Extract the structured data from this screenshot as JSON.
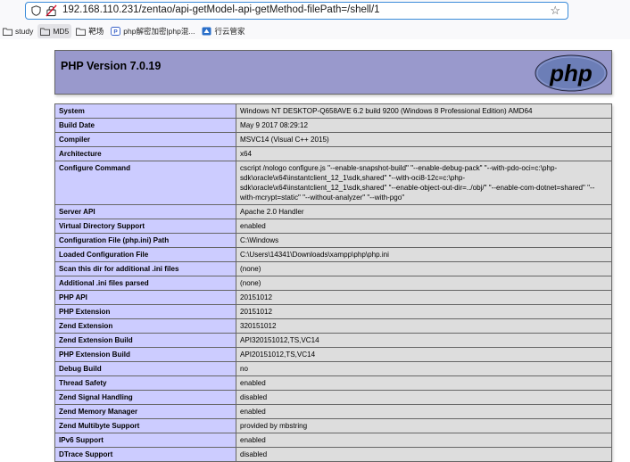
{
  "browser": {
    "url": "192.168.110.231/zentao/api-getModel-api-getMethod-filePath=/shell/1",
    "bookmarks": [
      {
        "label": "study",
        "icon": "folder-icon"
      },
      {
        "label": "MD5",
        "icon": "folder-icon"
      },
      {
        "label": "靶场",
        "icon": "folder-icon"
      },
      {
        "label": "php解密加密|php混...",
        "icon": "php-site-icon"
      },
      {
        "label": "行云管家",
        "icon": "cloud-site-icon"
      }
    ]
  },
  "phpinfo": {
    "title": "PHP Version 7.0.19",
    "logo_text": "php",
    "rows": [
      {
        "key": "System",
        "value": "Windows NT DESKTOP-Q658AVE 6.2 build 9200 (Windows 8 Professional Edition) AMD64"
      },
      {
        "key": "Build Date",
        "value": "May 9 2017 08:29:12"
      },
      {
        "key": "Compiler",
        "value": "MSVC14 (Visual C++ 2015)"
      },
      {
        "key": "Architecture",
        "value": "x64"
      },
      {
        "key": "Configure Command",
        "value": "cscript /nologo configure.js \"--enable-snapshot-build\" \"--enable-debug-pack\" \"--with-pdo-oci=c:\\php-sdk\\oracle\\x64\\instantclient_12_1\\sdk,shared\" \"--with-oci8-12c=c:\\php-sdk\\oracle\\x64\\instantclient_12_1\\sdk,shared\" \"--enable-object-out-dir=../obj/\" \"--enable-com-dotnet=shared\" \"--with-mcrypt=static\" \"--without-analyzer\" \"--with-pgo\""
      },
      {
        "key": "Server API",
        "value": "Apache 2.0 Handler"
      },
      {
        "key": "Virtual Directory Support",
        "value": "enabled"
      },
      {
        "key": "Configuration File (php.ini) Path",
        "value": "C:\\Windows"
      },
      {
        "key": "Loaded Configuration File",
        "value": "C:\\Users\\14341\\Downloads\\xampp\\php\\php.ini"
      },
      {
        "key": "Scan this dir for additional .ini files",
        "value": "(none)"
      },
      {
        "key": "Additional .ini files parsed",
        "value": "(none)"
      },
      {
        "key": "PHP API",
        "value": "20151012"
      },
      {
        "key": "PHP Extension",
        "value": "20151012"
      },
      {
        "key": "Zend Extension",
        "value": "320151012"
      },
      {
        "key": "Zend Extension Build",
        "value": "API320151012,TS,VC14"
      },
      {
        "key": "PHP Extension Build",
        "value": "API20151012,TS,VC14"
      },
      {
        "key": "Debug Build",
        "value": "no"
      },
      {
        "key": "Thread Safety",
        "value": "enabled"
      },
      {
        "key": "Zend Signal Handling",
        "value": "disabled"
      },
      {
        "key": "Zend Memory Manager",
        "value": "enabled"
      },
      {
        "key": "Zend Multibyte Support",
        "value": "provided by mbstring"
      },
      {
        "key": "IPv6 Support",
        "value": "enabled"
      },
      {
        "key": "DTrace Support",
        "value": "disabled"
      }
    ]
  },
  "colors": {
    "header_bg": "#9999cc",
    "key_bg": "#ccccff",
    "value_bg": "#dddddd",
    "url_focus": "#3a8bd9"
  }
}
